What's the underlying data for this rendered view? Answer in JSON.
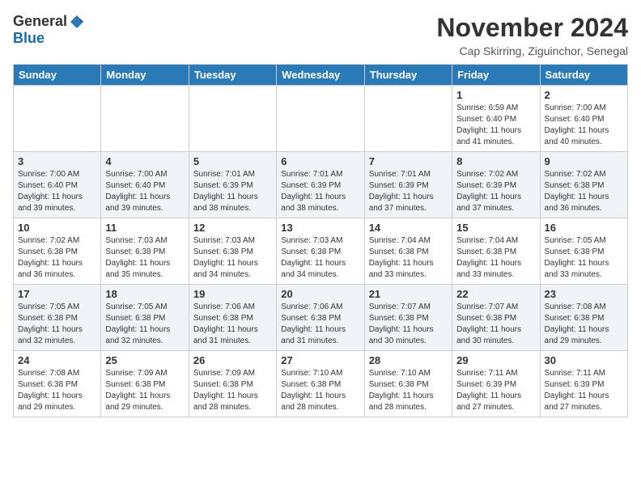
{
  "logo": {
    "general": "General",
    "blue": "Blue"
  },
  "title": "November 2024",
  "location": "Cap Skirring, Ziguinchor, Senegal",
  "days": [
    "Sunday",
    "Monday",
    "Tuesday",
    "Wednesday",
    "Thursday",
    "Friday",
    "Saturday"
  ],
  "weeks": [
    [
      {
        "day": "",
        "info": ""
      },
      {
        "day": "",
        "info": ""
      },
      {
        "day": "",
        "info": ""
      },
      {
        "day": "",
        "info": ""
      },
      {
        "day": "",
        "info": ""
      },
      {
        "day": "1",
        "info": "Sunrise: 6:59 AM\nSunset: 6:40 PM\nDaylight: 11 hours and 41 minutes."
      },
      {
        "day": "2",
        "info": "Sunrise: 7:00 AM\nSunset: 6:40 PM\nDaylight: 11 hours and 40 minutes."
      }
    ],
    [
      {
        "day": "3",
        "info": "Sunrise: 7:00 AM\nSunset: 6:40 PM\nDaylight: 11 hours and 39 minutes."
      },
      {
        "day": "4",
        "info": "Sunrise: 7:00 AM\nSunset: 6:40 PM\nDaylight: 11 hours and 39 minutes."
      },
      {
        "day": "5",
        "info": "Sunrise: 7:01 AM\nSunset: 6:39 PM\nDaylight: 11 hours and 38 minutes."
      },
      {
        "day": "6",
        "info": "Sunrise: 7:01 AM\nSunset: 6:39 PM\nDaylight: 11 hours and 38 minutes."
      },
      {
        "day": "7",
        "info": "Sunrise: 7:01 AM\nSunset: 6:39 PM\nDaylight: 11 hours and 37 minutes."
      },
      {
        "day": "8",
        "info": "Sunrise: 7:02 AM\nSunset: 6:39 PM\nDaylight: 11 hours and 37 minutes."
      },
      {
        "day": "9",
        "info": "Sunrise: 7:02 AM\nSunset: 6:38 PM\nDaylight: 11 hours and 36 minutes."
      }
    ],
    [
      {
        "day": "10",
        "info": "Sunrise: 7:02 AM\nSunset: 6:38 PM\nDaylight: 11 hours and 36 minutes."
      },
      {
        "day": "11",
        "info": "Sunrise: 7:03 AM\nSunset: 6:38 PM\nDaylight: 11 hours and 35 minutes."
      },
      {
        "day": "12",
        "info": "Sunrise: 7:03 AM\nSunset: 6:38 PM\nDaylight: 11 hours and 34 minutes."
      },
      {
        "day": "13",
        "info": "Sunrise: 7:03 AM\nSunset: 6:38 PM\nDaylight: 11 hours and 34 minutes."
      },
      {
        "day": "14",
        "info": "Sunrise: 7:04 AM\nSunset: 6:38 PM\nDaylight: 11 hours and 33 minutes."
      },
      {
        "day": "15",
        "info": "Sunrise: 7:04 AM\nSunset: 6:38 PM\nDaylight: 11 hours and 33 minutes."
      },
      {
        "day": "16",
        "info": "Sunrise: 7:05 AM\nSunset: 6:38 PM\nDaylight: 11 hours and 33 minutes."
      }
    ],
    [
      {
        "day": "17",
        "info": "Sunrise: 7:05 AM\nSunset: 6:38 PM\nDaylight: 11 hours and 32 minutes."
      },
      {
        "day": "18",
        "info": "Sunrise: 7:05 AM\nSunset: 6:38 PM\nDaylight: 11 hours and 32 minutes."
      },
      {
        "day": "19",
        "info": "Sunrise: 7:06 AM\nSunset: 6:38 PM\nDaylight: 11 hours and 31 minutes."
      },
      {
        "day": "20",
        "info": "Sunrise: 7:06 AM\nSunset: 6:38 PM\nDaylight: 11 hours and 31 minutes."
      },
      {
        "day": "21",
        "info": "Sunrise: 7:07 AM\nSunset: 6:38 PM\nDaylight: 11 hours and 30 minutes."
      },
      {
        "day": "22",
        "info": "Sunrise: 7:07 AM\nSunset: 6:38 PM\nDaylight: 11 hours and 30 minutes."
      },
      {
        "day": "23",
        "info": "Sunrise: 7:08 AM\nSunset: 6:38 PM\nDaylight: 11 hours and 29 minutes."
      }
    ],
    [
      {
        "day": "24",
        "info": "Sunrise: 7:08 AM\nSunset: 6:38 PM\nDaylight: 11 hours and 29 minutes."
      },
      {
        "day": "25",
        "info": "Sunrise: 7:09 AM\nSunset: 6:38 PM\nDaylight: 11 hours and 29 minutes."
      },
      {
        "day": "26",
        "info": "Sunrise: 7:09 AM\nSunset: 6:38 PM\nDaylight: 11 hours and 28 minutes."
      },
      {
        "day": "27",
        "info": "Sunrise: 7:10 AM\nSunset: 6:38 PM\nDaylight: 11 hours and 28 minutes."
      },
      {
        "day": "28",
        "info": "Sunrise: 7:10 AM\nSunset: 6:38 PM\nDaylight: 11 hours and 28 minutes."
      },
      {
        "day": "29",
        "info": "Sunrise: 7:11 AM\nSunset: 6:39 PM\nDaylight: 11 hours and 27 minutes."
      },
      {
        "day": "30",
        "info": "Sunrise: 7:11 AM\nSunset: 6:39 PM\nDaylight: 11 hours and 27 minutes."
      }
    ]
  ]
}
